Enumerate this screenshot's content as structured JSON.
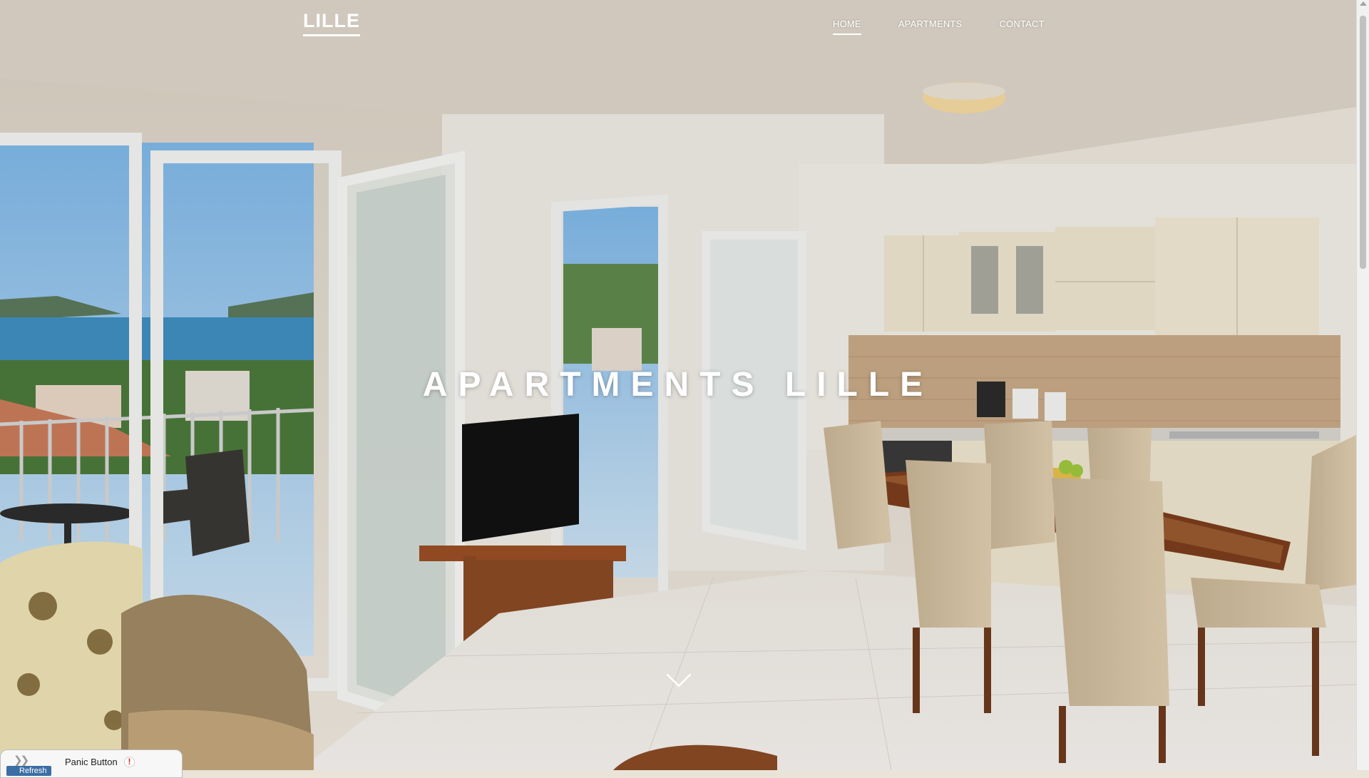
{
  "site": {
    "logo": "LILLE"
  },
  "nav": {
    "items": [
      {
        "label": "HOME",
        "active": true
      },
      {
        "label": "APARTMENTS",
        "active": false
      },
      {
        "label": "CONTACT",
        "active": false
      }
    ]
  },
  "hero": {
    "title": "APARTMENTS LILLE",
    "scroll_icon": "chevron-down-icon"
  },
  "panic_widget": {
    "label": "Panic Button",
    "icon": "warning-icon",
    "sub_label": "Refresh"
  },
  "colors": {
    "text": "#ffffff",
    "sea": "#3f8fc0",
    "sky": "#a9d0ee",
    "cabinet": "#efe5cf",
    "wood": "#8a4a25"
  }
}
